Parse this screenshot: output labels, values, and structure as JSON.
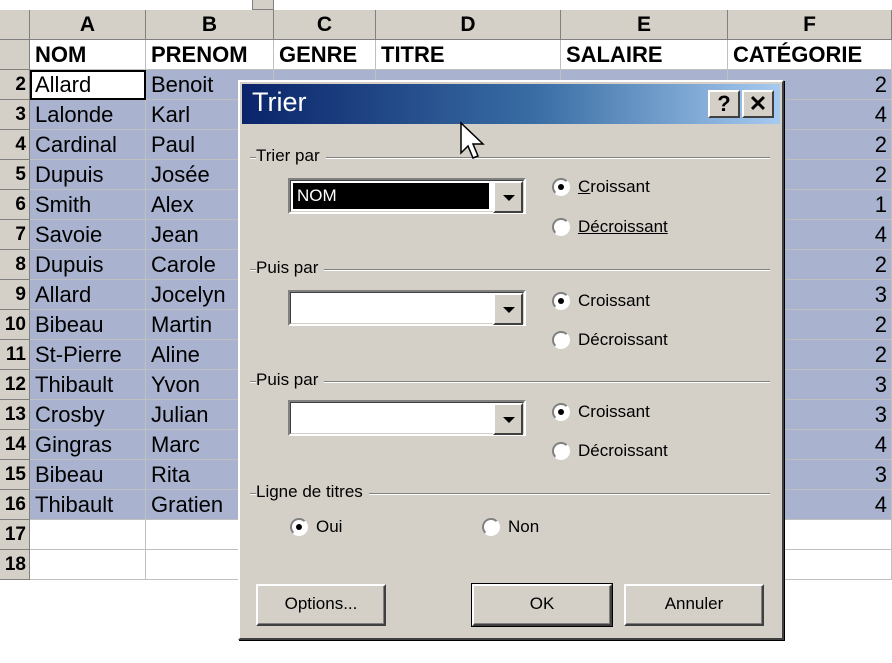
{
  "spreadsheet": {
    "columns": [
      "A",
      "B",
      "C",
      "D",
      "E",
      "F"
    ],
    "header_row": [
      "NOM",
      "PRENOM",
      "GENRE",
      "TITRE",
      "SALAIRE",
      "CATÉGORIE"
    ],
    "row_numbers": [
      "",
      "2",
      "3",
      "4",
      "5",
      "6",
      "7",
      "8",
      "9",
      "10",
      "11",
      "12",
      "13",
      "14",
      "15",
      "16",
      "17",
      "18"
    ],
    "rows": [
      {
        "nom": "Allard",
        "prenom": "Benoit",
        "cat": "2"
      },
      {
        "nom": "Lalonde",
        "prenom": "Karl",
        "cat": "4"
      },
      {
        "nom": "Cardinal",
        "prenom": "Paul",
        "cat": "2"
      },
      {
        "nom": "Dupuis",
        "prenom": "Josée",
        "cat": "2"
      },
      {
        "nom": "Smith",
        "prenom": "Alex",
        "cat": "1"
      },
      {
        "nom": "Savoie",
        "prenom": "Jean",
        "cat": "4"
      },
      {
        "nom": "Dupuis",
        "prenom": "Carole",
        "cat": "2"
      },
      {
        "nom": "Allard",
        "prenom": "Jocelyn",
        "cat": "3"
      },
      {
        "nom": "Bibeau",
        "prenom": "Martin",
        "cat": "2"
      },
      {
        "nom": "St-Pierre",
        "prenom": "Aline",
        "cat": "2"
      },
      {
        "nom": "Thibault",
        "prenom": "Yvon",
        "cat": "3"
      },
      {
        "nom": "Crosby",
        "prenom": "Julian",
        "cat": "3"
      },
      {
        "nom": "Gingras",
        "prenom": "Marc",
        "cat": "4"
      },
      {
        "nom": "Bibeau",
        "prenom": "Rita",
        "cat": "3"
      },
      {
        "nom": "Thibault",
        "prenom": "Gratien",
        "cat": "4"
      }
    ],
    "selection_color": "#a9b3cf"
  },
  "dialog": {
    "title": "Trier",
    "help_label": "?",
    "close_label": "✕",
    "sort_by": {
      "group_label": "Trier par",
      "value": "NOM",
      "ascending_label": "Croissant",
      "descending_label": "Décroissant",
      "selected": "ascending"
    },
    "then_by_1": {
      "group_label": "Puis par",
      "value": "",
      "ascending_label": "Croissant",
      "descending_label": "Décroissant",
      "selected": "ascending"
    },
    "then_by_2": {
      "group_label": "Puis par",
      "value": "",
      "ascending_label": "Croissant",
      "descending_label": "Décroissant",
      "selected": "ascending"
    },
    "header_row": {
      "group_label": "Ligne de titres",
      "yes_label": "Oui",
      "no_label": "Non",
      "selected": "yes"
    },
    "buttons": {
      "options": "Options...",
      "ok": "OK",
      "cancel": "Annuler"
    },
    "title_gradient": [
      "#0a246a",
      "#a6caf0"
    ]
  }
}
